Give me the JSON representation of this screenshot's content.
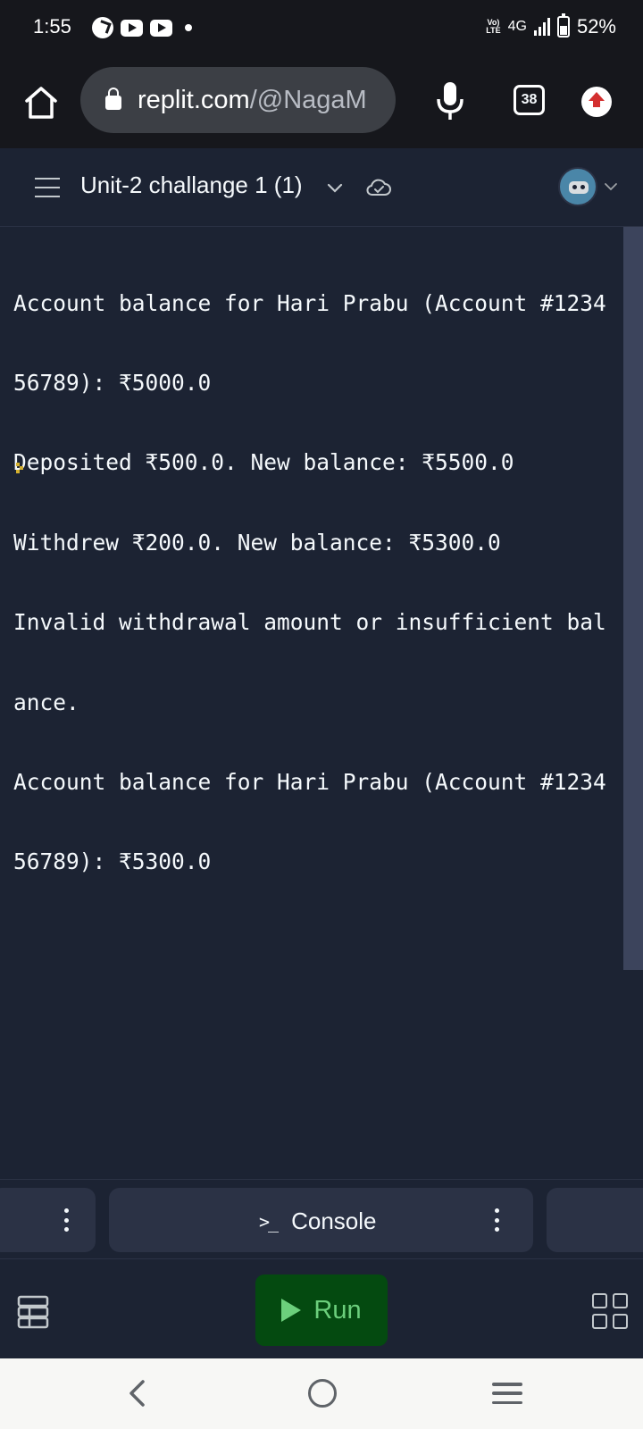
{
  "status_bar": {
    "time": "1:55",
    "volte": "Vo) LTE",
    "network": "4G",
    "battery": "52%",
    "icons": [
      "speed-dial-icon",
      "youtube-icon",
      "youtube-icon",
      "notification-dot-icon",
      "signal-icon",
      "battery-icon"
    ]
  },
  "browser": {
    "url_host": "replit.com",
    "url_path": "/@NagaM",
    "tab_count": "38",
    "icons": [
      "home-icon",
      "lock-icon",
      "mic-icon",
      "update-arrow-icon"
    ]
  },
  "header": {
    "repl_title": "Unit-2 challange 1 (1)",
    "icons": [
      "menu-icon",
      "chevron-down-icon",
      "cloud-check-icon",
      "avatar",
      "chevron-down-icon"
    ]
  },
  "console": {
    "lines": [
      "Account balance for Hari Prabu (Account #1234",
      "56789): ₹5000.0",
      "Deposited ₹500.0. New balance: ₹5500.0",
      "Withdrew ₹200.0. New balance: ₹5300.0",
      "Invalid withdrawal amount or insufficient bal",
      "ance.",
      "Account balance for Hari Prabu (Account #1234",
      "56789): ₹5300.0"
    ]
  },
  "tabs": {
    "console_label": "Console",
    "console_icon": ">_"
  },
  "toolbar": {
    "run_label": "Run"
  },
  "colors": {
    "background": "#1c2333",
    "surface": "#2b3245",
    "run_bg": "#044a10",
    "run_fg": "#6ccf7c",
    "prompt": "#d4b02e"
  }
}
